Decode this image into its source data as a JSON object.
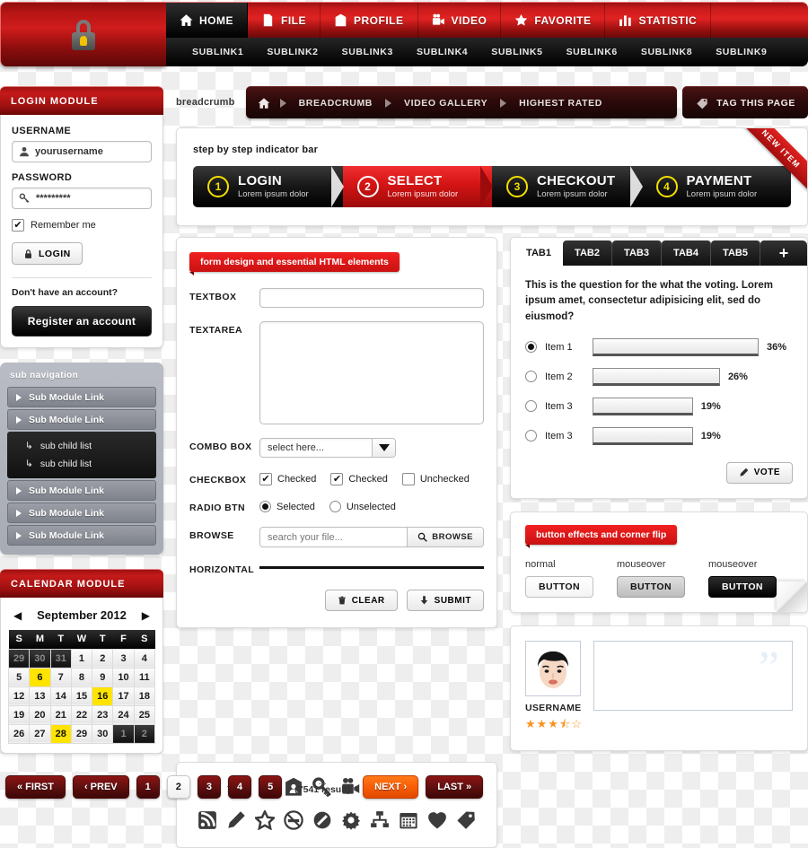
{
  "header": {
    "logo_icon": "lock-icon",
    "nav": [
      {
        "label": "HOME",
        "icon": "home-icon",
        "active": true
      },
      {
        "label": "FILE",
        "icon": "file-icon",
        "active": false
      },
      {
        "label": "PROFILE",
        "icon": "profile-icon",
        "active": false
      },
      {
        "label": "VIDEO",
        "icon": "video-camera-icon",
        "active": false
      },
      {
        "label": "FAVORITE",
        "icon": "star-icon",
        "active": false
      },
      {
        "label": "STATISTIC",
        "icon": "bar-chart-icon",
        "active": false
      }
    ],
    "sublinks": [
      "SUBLINK1",
      "SUBLINK2",
      "SUBLINK3",
      "SUBLINK4",
      "SUBLINK5",
      "SUBLINK6",
      "SUBLINK8",
      "SUBLINK9"
    ]
  },
  "login": {
    "title": "LOGIN MODULE",
    "username_label": "USERNAME",
    "username_value": "yourusername",
    "password_label": "PASSWORD",
    "password_value": "*********",
    "remember_label": "Remember me",
    "remember_checked": "✔",
    "login_button": "LOGIN",
    "no_account_text": "Don't have an account?",
    "register_button": "Register an account"
  },
  "subnav": {
    "title": "sub navigation",
    "items": [
      {
        "label": "Sub Module Link",
        "children": []
      },
      {
        "label": "Sub Module Link",
        "children": [
          "sub child list",
          "sub child list"
        ]
      },
      {
        "label": "Sub Module Link",
        "children": []
      },
      {
        "label": "Sub Module Link",
        "children": []
      },
      {
        "label": "Sub Module Link",
        "children": []
      }
    ]
  },
  "calendar": {
    "title": "CALENDAR MODULE",
    "month": "September 2012",
    "prev_icon": "chevron-left-icon",
    "next_icon": "chevron-right-icon",
    "weekdays": [
      "S",
      "M",
      "T",
      "W",
      "T",
      "F",
      "S"
    ],
    "weeks": [
      [
        {
          "d": "29",
          "t": "off"
        },
        {
          "d": "30",
          "t": "off"
        },
        {
          "d": "31",
          "t": "off"
        },
        {
          "d": "1",
          "t": ""
        },
        {
          "d": "2",
          "t": ""
        },
        {
          "d": "3",
          "t": ""
        },
        {
          "d": "4",
          "t": ""
        }
      ],
      [
        {
          "d": "5",
          "t": ""
        },
        {
          "d": "6",
          "t": "hl"
        },
        {
          "d": "7",
          "t": ""
        },
        {
          "d": "8",
          "t": ""
        },
        {
          "d": "9",
          "t": ""
        },
        {
          "d": "10",
          "t": ""
        },
        {
          "d": "11",
          "t": ""
        }
      ],
      [
        {
          "d": "12",
          "t": ""
        },
        {
          "d": "13",
          "t": ""
        },
        {
          "d": "14",
          "t": ""
        },
        {
          "d": "15",
          "t": ""
        },
        {
          "d": "16",
          "t": "hl"
        },
        {
          "d": "17",
          "t": ""
        },
        {
          "d": "18",
          "t": ""
        }
      ],
      [
        {
          "d": "19",
          "t": ""
        },
        {
          "d": "20",
          "t": ""
        },
        {
          "d": "21",
          "t": ""
        },
        {
          "d": "22",
          "t": ""
        },
        {
          "d": "23",
          "t": ""
        },
        {
          "d": "24",
          "t": ""
        },
        {
          "d": "25",
          "t": ""
        }
      ],
      [
        {
          "d": "26",
          "t": ""
        },
        {
          "d": "27",
          "t": ""
        },
        {
          "d": "28",
          "t": "hl"
        },
        {
          "d": "29",
          "t": ""
        },
        {
          "d": "30",
          "t": ""
        },
        {
          "d": "1",
          "t": "off"
        },
        {
          "d": "2",
          "t": "off"
        }
      ]
    ]
  },
  "breadcrumb": {
    "label": "breadcrumb",
    "home_icon": "home-icon",
    "items": [
      "BREADCRUMB",
      "VIDEO GALLERY",
      "HIGHEST RATED"
    ],
    "tag_button": "TAG THIS PAGE",
    "tag_icon": "tag-icon"
  },
  "steps": {
    "caption": "step by step indicator bar",
    "ribbon": "NEW ITEM",
    "items": [
      {
        "num": "1",
        "title": "LOGIN",
        "sub": "Lorem ipsum dolor",
        "active": false
      },
      {
        "num": "2",
        "title": "SELECT",
        "sub": "Lorem ipsum dolor",
        "active": true
      },
      {
        "num": "3",
        "title": "CHECKOUT",
        "sub": "Lorem ipsum dolor",
        "active": false
      },
      {
        "num": "4",
        "title": "PAYMENT",
        "sub": "Lorem ipsum dolor",
        "active": false
      }
    ]
  },
  "form": {
    "tag": "form design and essential HTML elements",
    "textbox_label": "TEXTBOX",
    "textbox_value": "",
    "textarea_label": "TEXTAREA",
    "textarea_value": "",
    "combo_label": "COMBO BOX",
    "combo_value": "select here...",
    "checkbox_label": "CHECKBOX",
    "checkboxes": [
      {
        "label": "Checked",
        "checked": true
      },
      {
        "label": "Checked",
        "checked": true
      },
      {
        "label": "Unchecked",
        "checked": false
      }
    ],
    "radio_label": "RADIO BTN",
    "radios": [
      {
        "label": "Selected",
        "selected": true
      },
      {
        "label": "Unselected",
        "selected": false
      }
    ],
    "browse_label": "BROWSE",
    "browse_placeholder": "search your file...",
    "browse_button": "BROWSE",
    "browse_icon": "search-icon",
    "horizontal_label": "HORIZONTAL",
    "clear_button": "CLEAR",
    "clear_icon": "trash-icon",
    "submit_button": "SUBMIT",
    "submit_icon": "arrow-down-icon"
  },
  "icons": {
    "row1": [
      "user-icon",
      "home-icon",
      "document-icon",
      "id-card-icon",
      "key-icon",
      "video-camera-icon",
      "star-icon",
      "notebook-icon",
      "bar-chart-icon",
      "trash-icon"
    ],
    "row2": [
      "rss-icon",
      "pencil-icon",
      "star-outline-icon",
      "no-smoking-icon",
      "prohibited-icon",
      "gear-icon",
      "sitemap-icon",
      "calendar-icon",
      "heart-icon",
      "tag-icon"
    ]
  },
  "tabs": {
    "items": [
      {
        "label": "TAB1",
        "active": true
      },
      {
        "label": "TAB2",
        "active": false
      },
      {
        "label": "TAB3",
        "active": false
      },
      {
        "label": "TAB4",
        "active": false
      },
      {
        "label": "TAB5",
        "active": false
      }
    ],
    "add_label": "+"
  },
  "poll": {
    "question": "This is the question for the what the voting. Lorem ipsum amet, consectetur adipisicing elit, sed do eiusmod?",
    "options": [
      {
        "label": "Item 1",
        "percent": "36%",
        "value": 36,
        "selected": true
      },
      {
        "label": "Item 2",
        "percent": "26%",
        "value": 26,
        "selected": false
      },
      {
        "label": "Item 3",
        "percent": "19%",
        "value": 19,
        "selected": false
      },
      {
        "label": "Item 3",
        "percent": "19%",
        "value": 19,
        "selected": false
      }
    ],
    "vote_button": "VOTE",
    "vote_icon": "pencil-icon"
  },
  "button_effects": {
    "tag": "button effects and corner flip",
    "items": [
      {
        "state": "normal",
        "label": "BUTTON",
        "style": "eff-normal"
      },
      {
        "state": "mouseover",
        "label": "BUTTON",
        "style": "eff-over"
      },
      {
        "state": "mouseover",
        "label": "BUTTON",
        "style": "eff-dark"
      }
    ]
  },
  "comment": {
    "username": "USERNAME",
    "avatar_icon": "avatar-icon",
    "rating": 3.5,
    "stars": "★★★⯪☆",
    "quote_glyph": "”",
    "body": ""
  },
  "pagination": {
    "first": "« FIRST",
    "prev": "‹ PREV",
    "pages": [
      {
        "label": "1",
        "active": false
      },
      {
        "label": "2",
        "active": true
      },
      {
        "label": "3",
        "active": false
      },
      {
        "label": "4",
        "active": false
      },
      {
        "label": "5",
        "active": false
      }
    ],
    "dots": "...",
    "result": "(7541 result)",
    "next": "NEXT ›",
    "last": "LAST »"
  },
  "colors": {
    "brand_red": "#c81a1a",
    "dark_red": "#6b0808",
    "accent_orange": "#f85d06",
    "highlight_yellow": "#ffe400",
    "black": "#000000",
    "star_orange": "#f79421"
  }
}
